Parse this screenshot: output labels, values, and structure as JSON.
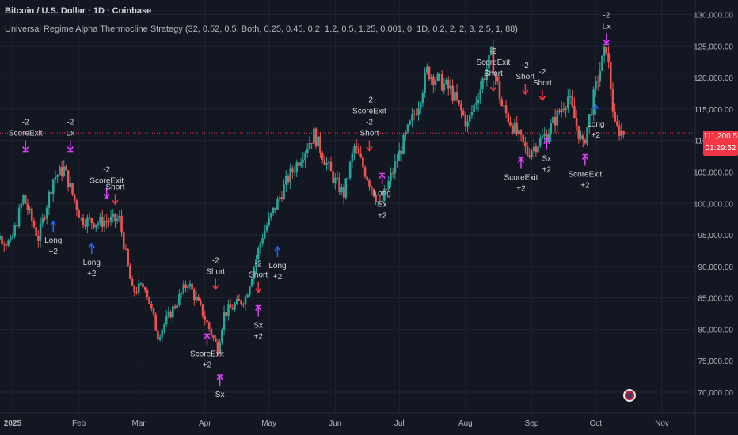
{
  "header": {
    "symbol_line": "Bitcoin / U.S. Dollar · 1D · Coinbase",
    "strategy_line": "Universal Regime Alpha Thermocline Strategy (32, 0.52, 0.5, Both, 0.25, 0.45, 0.2, 1.2, 0.5, 1.25, 0.001, 0, 1D, 0.2, 2, 2, 3, 2.5, 1, 88)"
  },
  "last_price": {
    "value": "111,200.57",
    "countdown": "01:29:52"
  },
  "colors": {
    "background": "#131722",
    "up": "#26a69a",
    "down": "#ef5350",
    "long_arrow": "#2962ff",
    "short_arrow": "#f23645",
    "exit_marker": "#e040fb",
    "grid": "#1f2430",
    "axis_text": "#b2b5be",
    "price_line": "#f23645"
  },
  "chart_data": {
    "type": "candlestick",
    "title": "Bitcoin / U.S. Dollar · 1D · Coinbase",
    "ylim": [
      69000,
      131500
    ],
    "y_ticks": [
      "70,000.00",
      "75,000.00",
      "80,000.00",
      "85,000.00",
      "90,000.00",
      "95,000.00",
      "100,000.00",
      "105,000.00",
      "110,000.00",
      "115,000.00",
      "120,000.00",
      "125,000.00",
      "130,000.00"
    ],
    "x_ticks": [
      "2025",
      "Feb",
      "Mar",
      "Apr",
      "May",
      "Jun",
      "Jul",
      "Aug",
      "Sep",
      "Oct",
      "Nov"
    ],
    "grid": true,
    "close_path": [
      [
        "2024-12-20",
        96000
      ],
      [
        "2024-12-31",
        93500
      ],
      [
        "2025-01-06",
        101000
      ],
      [
        "2025-01-13",
        94500
      ],
      [
        "2025-01-20",
        104000
      ],
      [
        "2025-01-25",
        105500
      ],
      [
        "2025-02-02",
        97500
      ],
      [
        "2025-02-10",
        97000
      ],
      [
        "2025-02-20",
        97500
      ],
      [
        "2025-02-26",
        86000
      ],
      [
        "2025-03-04",
        87000
      ],
      [
        "2025-03-10",
        79000
      ],
      [
        "2025-03-24",
        87500
      ],
      [
        "2025-03-31",
        82500
      ],
      [
        "2025-04-07",
        77000
      ],
      [
        "2025-04-10",
        82500
      ],
      [
        "2025-04-20",
        85000
      ],
      [
        "2025-04-28",
        95000
      ],
      [
        "2025-05-10",
        104000
      ],
      [
        "2025-05-22",
        111000
      ],
      [
        "2025-05-31",
        104000
      ],
      [
        "2025-06-05",
        101500
      ],
      [
        "2025-06-10",
        109000
      ],
      [
        "2025-06-22",
        99500
      ],
      [
        "2025-06-30",
        107000
      ],
      [
        "2025-07-10",
        116000
      ],
      [
        "2025-07-14",
        121000
      ],
      [
        "2025-07-25",
        118000
      ],
      [
        "2025-08-02",
        112500
      ],
      [
        "2025-08-13",
        123500
      ],
      [
        "2025-08-18",
        115500
      ],
      [
        "2025-08-30",
        108000
      ],
      [
        "2025-09-08",
        111000
      ],
      [
        "2025-09-18",
        117000
      ],
      [
        "2025-09-25",
        109000
      ],
      [
        "2025-10-02",
        120000
      ],
      [
        "2025-10-06",
        125000
      ],
      [
        "2025-10-10",
        112000
      ],
      [
        "2025-10-14",
        111200
      ]
    ],
    "signals": [
      {
        "date": "2025-01-07",
        "kind": "exit-down",
        "price": 108500,
        "lines": [
          "-2",
          "ScoreExit"
        ]
      },
      {
        "date": "2025-01-20",
        "kind": "long",
        "price": 97000,
        "lines": [
          "Long",
          "+2"
        ]
      },
      {
        "date": "2025-01-28",
        "kind": "exit-down",
        "price": 108500,
        "lines": [
          "-2",
          "Lx"
        ]
      },
      {
        "date": "2025-02-07",
        "kind": "long",
        "price": 93500,
        "lines": [
          "Long",
          "+2"
        ]
      },
      {
        "date": "2025-02-14",
        "kind": "exit-down",
        "price": 101000,
        "lines": [
          "-2",
          "ScoreExit"
        ]
      },
      {
        "date": "2025-02-18",
        "kind": "short",
        "price": 100000,
        "lines": [
          "Short"
        ]
      },
      {
        "date": "2025-04-02",
        "kind": "exit-up",
        "price": 79000,
        "lines": [
          "ScoreExit",
          "+2"
        ]
      },
      {
        "date": "2025-04-06",
        "kind": "short",
        "price": 86500,
        "lines": [
          "-2",
          "Short"
        ]
      },
      {
        "date": "2025-04-08",
        "kind": "exit-up",
        "price": 72500,
        "lines": [
          "Sx"
        ]
      },
      {
        "date": "2025-04-26",
        "kind": "short",
        "price": 86000,
        "lines": [
          "-2",
          "Short"
        ]
      },
      {
        "date": "2025-04-26",
        "kind": "exit-up",
        "price": 83500,
        "lines": [
          "Sx",
          "+2"
        ]
      },
      {
        "date": "2025-05-05",
        "kind": "long",
        "price": 93000,
        "lines": [
          "Long",
          "+2"
        ]
      },
      {
        "date": "2025-06-17",
        "kind": "short",
        "price": 108500,
        "lines": [
          "-2",
          "ScoreExit",
          "-2",
          "Short"
        ]
      },
      {
        "date": "2025-06-23",
        "kind": "exit-up",
        "price": 104500,
        "lines": [
          "Long",
          "Sx",
          "+2"
        ]
      },
      {
        "date": "2025-08-14",
        "kind": "short",
        "price": 118000,
        "lines": [
          "-2",
          "ScoreExit",
          "Short"
        ]
      },
      {
        "date": "2025-08-27",
        "kind": "exit-up",
        "price": 107000,
        "lines": [
          "ScoreExit",
          "+2"
        ]
      },
      {
        "date": "2025-08-29",
        "kind": "short",
        "price": 117500,
        "lines": [
          "-2",
          "Short"
        ]
      },
      {
        "date": "2025-09-06",
        "kind": "short",
        "price": 116500,
        "lines": [
          "-2",
          "Short"
        ]
      },
      {
        "date": "2025-09-08",
        "kind": "exit-up",
        "price": 110000,
        "lines": [
          "Sx",
          "+2"
        ]
      },
      {
        "date": "2025-09-26",
        "kind": "exit-up",
        "price": 107500,
        "lines": [
          "ScoreExit",
          "+2"
        ]
      },
      {
        "date": "2025-10-01",
        "kind": "long",
        "price": 115500,
        "lines": [
          "Long",
          "+2"
        ]
      },
      {
        "date": "2025-10-06",
        "kind": "exit-down",
        "price": 125500,
        "lines": [
          "-2",
          "Lx"
        ]
      }
    ],
    "last_price": 111200.57
  }
}
